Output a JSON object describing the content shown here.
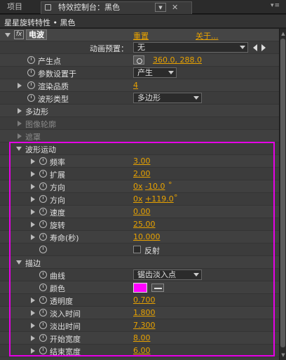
{
  "tabs": {
    "projects": "项目",
    "effect_controls": "特效控制台：黑色"
  },
  "subheader": "星星旋转特性 • 黑色",
  "effect": {
    "fx_badge": "fx",
    "name": "电波",
    "reset": "重置",
    "about": "关于..."
  },
  "animation_preset": {
    "label": "动画预置：",
    "value": "无"
  },
  "producer_point": {
    "label": "产生点",
    "value": "360.0, 288.0"
  },
  "param_settings": {
    "label": "参数设置于",
    "value": "产生"
  },
  "render_quality": {
    "label": "渲染品质",
    "value": "4"
  },
  "wave_type": {
    "label": "波形类型",
    "value": "多边形"
  },
  "groups": {
    "polygon": "多边形",
    "image_contour": "图像轮廓",
    "mask": "遮罩"
  },
  "wave_motion": {
    "label": "波形运动",
    "frequency": {
      "label": "频率",
      "value": "3.00"
    },
    "expansion": {
      "label": "扩展",
      "value": "2.00"
    },
    "direction": {
      "label": "方向",
      "turns": "0x",
      "value": "-10.0",
      "deg": "°"
    },
    "direction2": {
      "label": "方向",
      "turns": "0x",
      "value": "+119.0",
      "deg": "°"
    },
    "velocity": {
      "label": "速度",
      "value": "0.00"
    },
    "spin": {
      "label": "旋转",
      "value": "25.00"
    },
    "lifespan": {
      "label": "寿命(秒)",
      "value": "10.000"
    },
    "reflection": {
      "label": "反射"
    }
  },
  "stroke": {
    "label": "描边",
    "profile": {
      "label": "曲线",
      "value": "锯齿淡入点"
    },
    "color": {
      "label": "颜色",
      "value": "#ff00ff"
    },
    "opacity": {
      "label": "透明度",
      "value": "0.700"
    },
    "fade_in": {
      "label": "淡入时间",
      "value": "1.800"
    },
    "fade_out": {
      "label": "淡出时间",
      "value": "7.300"
    },
    "start_width": {
      "label": "开始宽度",
      "value": "8.00"
    },
    "end_width": {
      "label": "结束宽度",
      "value": "6.00"
    }
  },
  "colors": {
    "accent": "#e8a200",
    "highlight": "#e600e6"
  }
}
